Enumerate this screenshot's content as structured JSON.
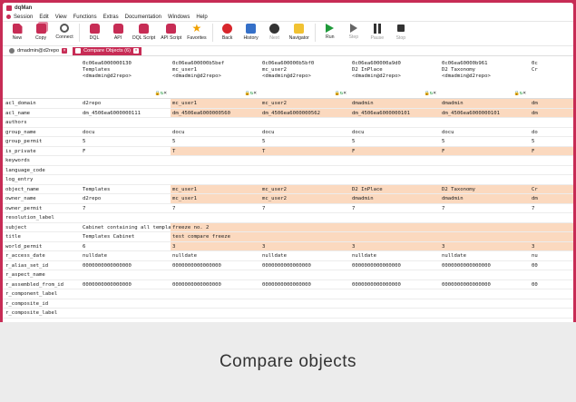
{
  "app": {
    "title": "dqMan",
    "accent": "#c72c55"
  },
  "menu": [
    "Session",
    "Edit",
    "View",
    "Functions",
    "Extras",
    "Documentation",
    "Windows",
    "Help"
  ],
  "toolbar": [
    {
      "label": "New",
      "icon": "new-document-icon",
      "kind": "doc",
      "disabled": false
    },
    {
      "label": "Copy",
      "icon": "copy-icon",
      "kind": "copy",
      "disabled": false
    },
    {
      "label": "Connect",
      "icon": "connect-icon",
      "kind": "conn",
      "disabled": false
    },
    {
      "label": "DQL",
      "icon": "dql-icon",
      "kind": "db",
      "disabled": false
    },
    {
      "label": "API",
      "icon": "api-icon",
      "kind": "db",
      "disabled": false
    },
    {
      "label": "DQL Script",
      "icon": "dql-script-icon",
      "kind": "db",
      "disabled": false
    },
    {
      "label": "API Script",
      "icon": "api-script-icon",
      "kind": "db",
      "disabled": false
    },
    {
      "label": "Favorites",
      "icon": "star-icon",
      "kind": "star",
      "disabled": false
    },
    {
      "label": "Back",
      "icon": "back-icon",
      "kind": "back",
      "disabled": false
    },
    {
      "label": "History",
      "icon": "history-icon",
      "kind": "hist",
      "disabled": false
    },
    {
      "label": "Next",
      "icon": "next-icon",
      "kind": "next",
      "disabled": true
    },
    {
      "label": "Navigator",
      "icon": "navigator-icon",
      "kind": "nav",
      "disabled": false
    },
    {
      "label": "Run",
      "icon": "run-icon",
      "kind": "run",
      "disabled": false
    },
    {
      "label": "Step",
      "icon": "step-icon",
      "kind": "step",
      "disabled": true
    },
    {
      "label": "Pause",
      "icon": "pause-icon",
      "kind": "pause",
      "disabled": true
    },
    {
      "label": "Stop",
      "icon": "stop-icon",
      "kind": "stop",
      "disabled": true
    }
  ],
  "tabs": [
    {
      "label": "dmadmin@d2repo",
      "active": false
    },
    {
      "label": "Compare Objects (6)",
      "active": true
    }
  ],
  "grid": {
    "columns": [
      {
        "lines": [
          "0c06ea6000000130",
          "Templates",
          "<dmadmin@d2repo>"
        ],
        "icons": true
      },
      {
        "lines": [
          "0c06ea600000b5bef",
          "mc_user1",
          "<dmadmin@d2repo>"
        ],
        "icons": true
      },
      {
        "lines": [
          "0c06ea600000b5bf0",
          "mc_user2",
          "<dmadmin@d2repo>"
        ],
        "icons": true
      },
      {
        "lines": [
          "0c06ea600000a9d0",
          "D2 InPlace",
          "<dmadmin@d2repo>"
        ],
        "icons": true
      },
      {
        "lines": [
          "0c06ea60000b961",
          "D2 Taxonomy",
          "<dmadmin@d2repo>"
        ],
        "icons": true
      },
      {
        "lines": [
          "0c",
          "Cr",
          ""
        ],
        "icons": false
      }
    ],
    "rows": [
      {
        "name": "acl_domain",
        "values": [
          "d2repo",
          "mc_user1",
          "mc_user2",
          "dmadmin",
          "dmadmin",
          "dm"
        ],
        "diff": [
          1,
          2,
          3,
          4,
          5
        ]
      },
      {
        "name": "acl_name",
        "values": [
          "dm_4506ea6000000111",
          "dm_4506ea6000000560",
          "dm_4506ea6000000562",
          "dm_4506ea6000000101",
          "dm_4506ea6000000101",
          "dm"
        ],
        "diff": [
          1,
          2,
          3,
          4,
          5
        ]
      },
      {
        "name": "authors",
        "values": [
          "",
          "",
          "",
          "",
          "",
          ""
        ],
        "diff": []
      },
      {
        "name": "group_name",
        "values": [
          "docu",
          "docu",
          "docu",
          "docu",
          "docu",
          "do"
        ],
        "diff": []
      },
      {
        "name": "group_permit",
        "values": [
          "5",
          "5",
          "5",
          "5",
          "5",
          "5"
        ],
        "diff": []
      },
      {
        "name": "is_private",
        "values": [
          "F",
          "T",
          "T",
          "F",
          "F",
          "F"
        ],
        "diff": [
          1,
          2,
          3,
          4,
          5
        ]
      },
      {
        "name": "keywords",
        "values": [
          "",
          "",
          "",
          "",
          "",
          ""
        ],
        "diff": []
      },
      {
        "name": "language_code",
        "values": [
          "",
          "",
          "",
          "",
          "",
          ""
        ],
        "diff": []
      },
      {
        "name": "log_entry",
        "values": [
          "",
          "",
          "",
          "",
          "",
          ""
        ],
        "diff": []
      },
      {
        "name": "object_name",
        "values": [
          "Templates",
          "mc_user1",
          "mc_user2",
          "D2 InPlace",
          "D2 Taxonomy",
          "Cr"
        ],
        "diff": [
          1,
          2,
          3,
          4,
          5
        ]
      },
      {
        "name": "owner_name",
        "values": [
          "d2repo",
          "mc_user1",
          "mc_user2",
          "dmadmin",
          "dmadmin",
          "dm"
        ],
        "diff": [
          1,
          2,
          3,
          4,
          5
        ]
      },
      {
        "name": "owner_permit",
        "values": [
          "7",
          "7",
          "7",
          "7",
          "7",
          "7"
        ],
        "diff": []
      },
      {
        "name": "resolution_label",
        "values": [
          "",
          "",
          "",
          "",
          "",
          ""
        ],
        "diff": []
      },
      {
        "name": "subject",
        "values": [
          "Cabinet containing all template objs - doc",
          "freeze no. 2",
          "",
          "",
          "",
          ""
        ],
        "diff": [
          1,
          2,
          3,
          4,
          5
        ]
      },
      {
        "name": "title",
        "values": [
          "Templates Cabinet",
          "test compare freeze",
          "",
          "",
          "",
          ""
        ],
        "diff": [
          1,
          2,
          3,
          4,
          5
        ]
      },
      {
        "name": "world_permit",
        "values": [
          "6",
          "3",
          "3",
          "3",
          "3",
          "3"
        ],
        "diff": [
          1,
          2,
          3,
          4,
          5
        ]
      },
      {
        "name": "r_access_date",
        "values": [
          "nulldate",
          "nulldate",
          "nulldate",
          "nulldate",
          "nulldate",
          "nu"
        ],
        "diff": []
      },
      {
        "name": "r_alias_set_id",
        "values": [
          "0000000000000000",
          "0000000000000000",
          "0000000000000000",
          "0000000000000000",
          "0000000000000000",
          "00"
        ],
        "diff": []
      },
      {
        "name": "r_aspect_name",
        "values": [
          "",
          "",
          "",
          "",
          "",
          ""
        ],
        "diff": []
      },
      {
        "name": "r_assembled_from_id",
        "values": [
          "0000000000000000",
          "0000000000000000",
          "0000000000000000",
          "0000000000000000",
          "0000000000000000",
          "00"
        ],
        "diff": []
      },
      {
        "name": "r_component_label",
        "values": [
          "",
          "",
          "",
          "",
          "",
          ""
        ],
        "diff": []
      },
      {
        "name": "r_composite_id",
        "values": [
          "",
          "",
          "",
          "",
          "",
          ""
        ],
        "diff": []
      },
      {
        "name": "r_composite_label",
        "values": [
          "",
          "",
          "",
          "",
          "",
          ""
        ],
        "diff": []
      }
    ]
  },
  "caption": "Compare objects"
}
